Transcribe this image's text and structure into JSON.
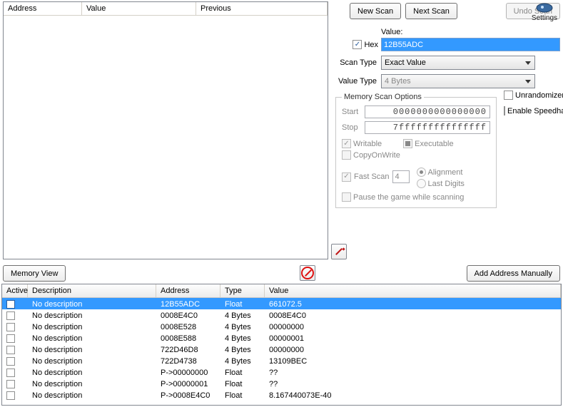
{
  "scan_results_headers": {
    "address": "Address",
    "value": "Value",
    "previous": "Previous"
  },
  "buttons": {
    "new_scan": "New Scan",
    "next_scan": "Next Scan",
    "undo_scan": "Undo Scan",
    "memory_view": "Memory View",
    "add_manual": "Add Address Manually"
  },
  "settings_label": "Settings",
  "labels": {
    "value": "Value:",
    "hex": "Hex",
    "scan_type": "Scan Type",
    "value_type": "Value Type"
  },
  "input_value": "12B55ADC",
  "scan_type": "Exact Value",
  "value_type": "4 Bytes",
  "mso": {
    "legend": "Memory Scan Options",
    "start_label": "Start",
    "stop_label": "Stop",
    "start": "0000000000000000",
    "stop": "7fffffffffffffff",
    "writable": "Writable",
    "executable": "Executable",
    "cow": "CopyOnWrite",
    "fast_scan": "Fast Scan",
    "fast_value": "4",
    "alignment": "Alignment",
    "last_digits": "Last Digits",
    "pause": "Pause the game while scanning"
  },
  "extras": {
    "unrandomizer": "Unrandomizer",
    "speedhack": "Enable Speedhack"
  },
  "addr_list_headers": {
    "active": "Active",
    "description": "Description",
    "address": "Address",
    "type": "Type",
    "value": "Value"
  },
  "rows": [
    {
      "desc": "No description",
      "addr": "12B55ADC",
      "type": "Float",
      "value": "661072.5",
      "selected": true
    },
    {
      "desc": "No description",
      "addr": "0008E4C0",
      "type": "4 Bytes",
      "value": "0008E4C0",
      "selected": false
    },
    {
      "desc": "No description",
      "addr": "0008E528",
      "type": "4 Bytes",
      "value": "00000000",
      "selected": false
    },
    {
      "desc": "No description",
      "addr": "0008E588",
      "type": "4 Bytes",
      "value": "00000001",
      "selected": false
    },
    {
      "desc": "No description",
      "addr": "722D46D8",
      "type": "4 Bytes",
      "value": "00000000",
      "selected": false
    },
    {
      "desc": "No description",
      "addr": "722D4738",
      "type": "4 Bytes",
      "value": "13109BEC",
      "selected": false
    },
    {
      "desc": "No description",
      "addr": "P->00000000",
      "type": "Float",
      "value": "??",
      "selected": false
    },
    {
      "desc": "No description",
      "addr": "P->00000001",
      "type": "Float",
      "value": "??",
      "selected": false
    },
    {
      "desc": "No description",
      "addr": "P->0008E4C0",
      "type": "Float",
      "value": "8.167440073E-40",
      "selected": false
    }
  ]
}
